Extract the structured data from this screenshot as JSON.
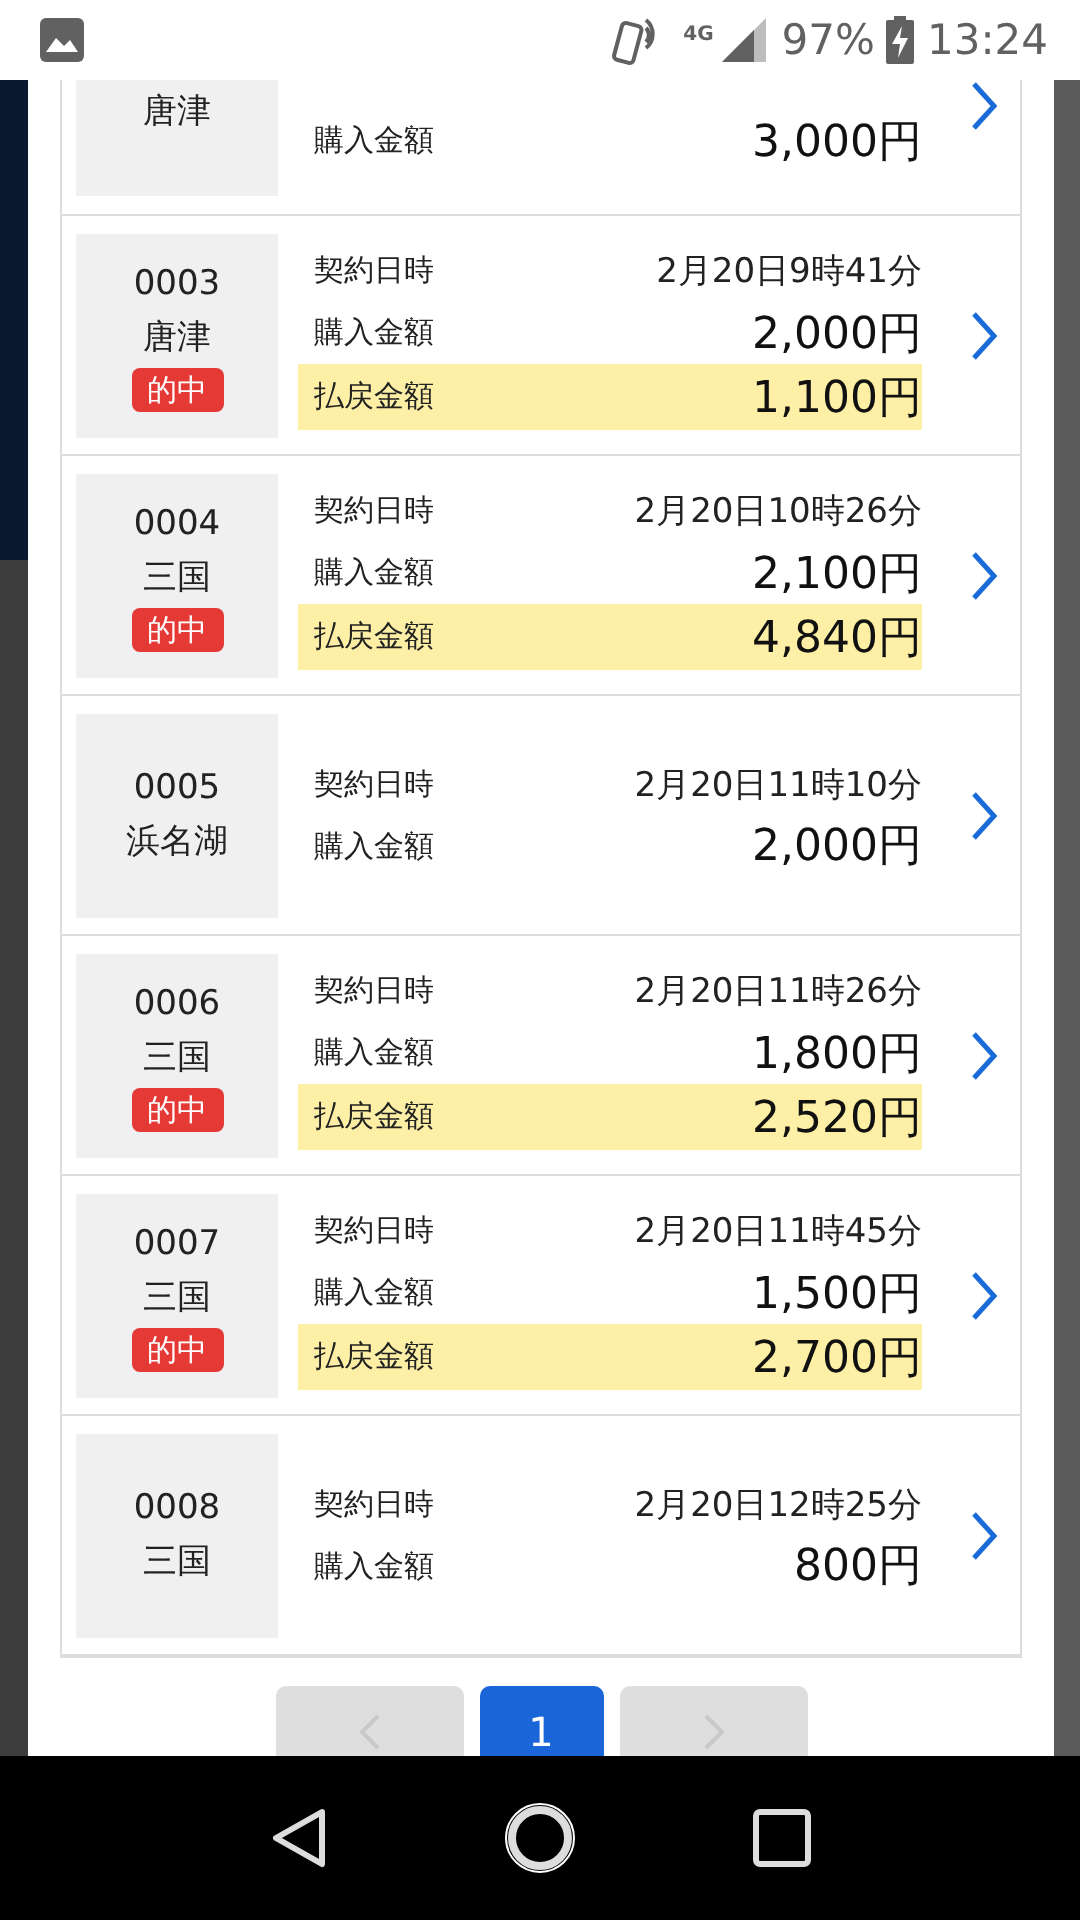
{
  "status_bar": {
    "network": "4G",
    "battery": "97%",
    "time": "13:24"
  },
  "rows": [
    {
      "number": "",
      "venue": "唐津",
      "date_label": "",
      "date": "",
      "purchase_label": "購入金額",
      "purchase": "3,000円",
      "badge": "",
      "payout_label": "",
      "payout": ""
    },
    {
      "number": "0003",
      "venue": "唐津",
      "date_label": "契約日時",
      "date": "2月20日9時41分",
      "purchase_label": "購入金額",
      "purchase": "2,000円",
      "badge": "的中",
      "payout_label": "払戻金額",
      "payout": "1,100円"
    },
    {
      "number": "0004",
      "venue": "三国",
      "date_label": "契約日時",
      "date": "2月20日10時26分",
      "purchase_label": "購入金額",
      "purchase": "2,100円",
      "badge": "的中",
      "payout_label": "払戻金額",
      "payout": "4,840円"
    },
    {
      "number": "0005",
      "venue": "浜名湖",
      "date_label": "契約日時",
      "date": "2月20日11時10分",
      "purchase_label": "購入金額",
      "purchase": "2,000円",
      "badge": "",
      "payout_label": "",
      "payout": ""
    },
    {
      "number": "0006",
      "venue": "三国",
      "date_label": "契約日時",
      "date": "2月20日11時26分",
      "purchase_label": "購入金額",
      "purchase": "1,800円",
      "badge": "的中",
      "payout_label": "払戻金額",
      "payout": "2,520円"
    },
    {
      "number": "0007",
      "venue": "三国",
      "date_label": "契約日時",
      "date": "2月20日11時45分",
      "purchase_label": "購入金額",
      "purchase": "1,500円",
      "badge": "的中",
      "payout_label": "払戻金額",
      "payout": "2,700円"
    },
    {
      "number": "0008",
      "venue": "三国",
      "date_label": "契約日時",
      "date": "2月20日12時25分",
      "purchase_label": "購入金額",
      "purchase": "800円",
      "badge": "",
      "payout_label": "",
      "payout": ""
    }
  ],
  "pagination": {
    "pages": [
      {
        "label": "1",
        "selected": true
      }
    ]
  }
}
